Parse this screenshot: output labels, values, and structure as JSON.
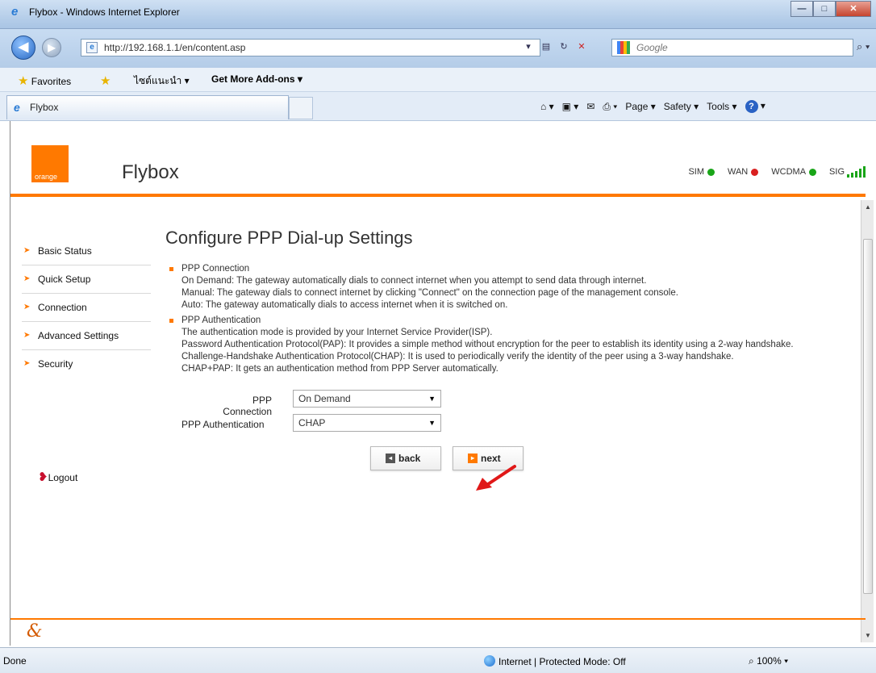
{
  "browser": {
    "window_title": "Flybox - Windows Internet Explorer",
    "address": "http://192.168.1.1/en/content.asp",
    "address_host": "192.168.1.1",
    "search_placeholder": "Google",
    "favorites_label": "Favorites",
    "fav_item_1": "ไซต์แนะนำ ▾",
    "fav_item_2": "Get More Add-ons ▾",
    "tab_label": "Flybox",
    "cmd": {
      "page": "Page ▾",
      "safety": "Safety ▾",
      "tools": "Tools ▾"
    },
    "status_text": "Done",
    "zone_text": "Internet | Protected Mode: Off",
    "zoom_text": "100%"
  },
  "header": {
    "logo_text": "orange",
    "brand": "Flybox",
    "indicators": [
      {
        "label": "SIM",
        "color": "#19a518"
      },
      {
        "label": "WAN",
        "color": "#d92020"
      },
      {
        "label": "WCDMA",
        "color": "#19a518"
      },
      {
        "label": "SIG",
        "color": "#19a518"
      }
    ]
  },
  "sidebar": {
    "items": [
      {
        "label": "Basic Status"
      },
      {
        "label": "Quick Setup"
      },
      {
        "label": "Connection"
      },
      {
        "label": "Advanced Settings"
      },
      {
        "label": "Security"
      }
    ],
    "logout": "Logout"
  },
  "main": {
    "title": "Configure PPP Dial-up Settings",
    "sections": [
      {
        "heading": "PPP Connection",
        "lines": [
          "On Demand: The gateway automatically dials to connect internet when you attempt to send data through internet.",
          "Manual: The gateway dials to connect internet by clicking \"Connect\" on the connection page of the management console.",
          "Auto: The gateway automatically dials to access internet when it is switched on."
        ]
      },
      {
        "heading": "PPP Authentication",
        "lines": [
          "The authentication mode is provided by your Internet Service Provider(ISP).",
          "Password Authentication Protocol(PAP): It provides a simple method without encryption for the peer to establish its identity using a 2-way handshake.",
          "Challenge-Handshake Authentication Protocol(CHAP): It is used to periodically verify the identity of the peer using a 3-way handshake.",
          "CHAP+PAP: It gets an authentication method from PPP Server automatically."
        ]
      }
    ],
    "form": {
      "ppp_connection_label": "PPP Connection",
      "ppp_connection_value": "On Demand",
      "ppp_auth_label": "PPP Authentication",
      "ppp_auth_value": "CHAP"
    },
    "buttons": {
      "back": "back",
      "next": "next"
    }
  },
  "colors": {
    "accent": "#ff7900",
    "arrow": "#e01818"
  }
}
